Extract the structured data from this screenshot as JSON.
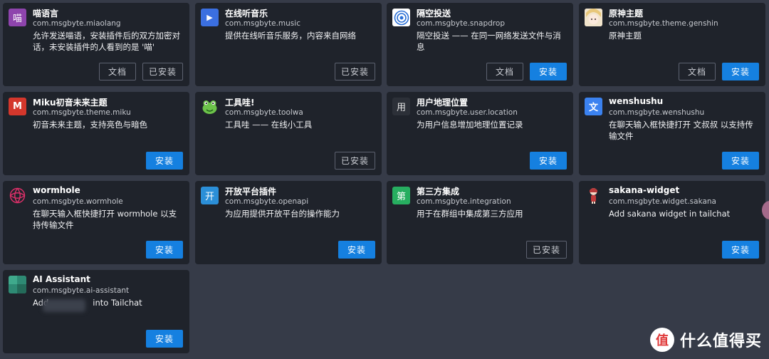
{
  "plugins": [
    {
      "name": "喵语言",
      "pkg": "com.msgbyte.miaolang",
      "desc": "允许发送喵语，安装插件后的双方加密对话，未安装插件的人看到的是 '喵'",
      "icon": "miaolang-icon",
      "icon_text": "喵",
      "icon_color": "#8e44ad",
      "buttons": [
        "文档",
        "已安装"
      ]
    },
    {
      "name": "在线听音乐",
      "pkg": "com.msgbyte.music",
      "desc": "提供在线听音乐服务，内容来自网络",
      "icon": "music-play-icon",
      "icon_text": "▶",
      "icon_color": "#3b6fe0",
      "buttons": [
        "已安装"
      ]
    },
    {
      "name": "隔空投送",
      "pkg": "com.msgbyte.snapdrop",
      "desc": "隔空投送 —— 在同一网络发送文件与消息",
      "icon": "snapdrop-icon",
      "icon_text": "",
      "icon_color": "#ffffff",
      "buttons": [
        "文档",
        "安装"
      ]
    },
    {
      "name": "原神主题",
      "pkg": "com.msgbyte.theme.genshin",
      "desc": "原神主题",
      "icon": "genshin-avatar-icon",
      "icon_text": "",
      "icon_color": "#e9d7b8",
      "buttons": [
        "文档",
        "安装"
      ]
    },
    {
      "name": "Miku初音未来主题",
      "pkg": "com.msgbyte.theme.miku",
      "desc": "初音未来主题，支持亮色与暗色",
      "icon": "miku-icon",
      "icon_text": "M",
      "icon_color": "#d4372c",
      "buttons": [
        "安装"
      ]
    },
    {
      "name": "工具哇!",
      "pkg": "com.msgbyte.toolwa",
      "desc": "工具哇 —— 在线小工具",
      "icon": "frog-icon",
      "icon_text": "",
      "icon_color": "#1f232b",
      "buttons": [
        "已安装"
      ]
    },
    {
      "name": "用户地理位置",
      "pkg": "com.msgbyte.user.location",
      "desc": "为用户信息增加地理位置记录",
      "icon": "location-icon",
      "icon_text": "用",
      "icon_color": "#2c3038",
      "buttons": [
        "安装"
      ]
    },
    {
      "name": "wenshushu",
      "pkg": "com.msgbyte.wenshushu",
      "desc": "在聊天输入框快捷打开 文叔叔 以支持传输文件",
      "icon": "wenshushu-icon",
      "icon_text": "文",
      "icon_color": "#3b82f0",
      "buttons": [
        "安装"
      ]
    },
    {
      "name": "wormhole",
      "pkg": "com.msgbyte.wormhole",
      "desc": "在聊天输入框快捷打开 wormhole 以支持传输文件",
      "icon": "wormhole-icon",
      "icon_text": "",
      "icon_color": "#1f232b",
      "buttons": [
        "安装"
      ]
    },
    {
      "name": "开放平台插件",
      "pkg": "com.msgbyte.openapi",
      "desc": "为应用提供开放平台的操作能力",
      "icon": "openapi-icon",
      "icon_text": "开",
      "icon_color": "#2b8fd8",
      "buttons": [
        "安装"
      ]
    },
    {
      "name": "第三方集成",
      "pkg": "com.msgbyte.integration",
      "desc": "用于在群组中集成第三方应用",
      "icon": "integration-icon",
      "icon_text": "第",
      "icon_color": "#27ae60",
      "buttons": [
        "已安装"
      ]
    },
    {
      "name": "sakana-widget",
      "pkg": "com.msgbyte.widget.sakana",
      "desc": "Add sakana widget in tailchat",
      "icon": "sakana-icon",
      "icon_text": "",
      "icon_color": "#1f232b",
      "buttons": [
        "安装"
      ]
    },
    {
      "name": "AI Assistant",
      "pkg": "com.msgbyte.ai-assistant",
      "desc": "Add",
      "desc_tail": "into Tailchat",
      "icon": "ai-assistant-icon",
      "icon_text": "",
      "icon_color": "#2e8a74",
      "buttons": [
        "安装"
      ]
    }
  ],
  "watermark": {
    "logo_text": "值",
    "text": "什么值得买"
  },
  "colors": {
    "background": "#363b48",
    "card": "#1f232b",
    "primary": "#1580e0"
  }
}
